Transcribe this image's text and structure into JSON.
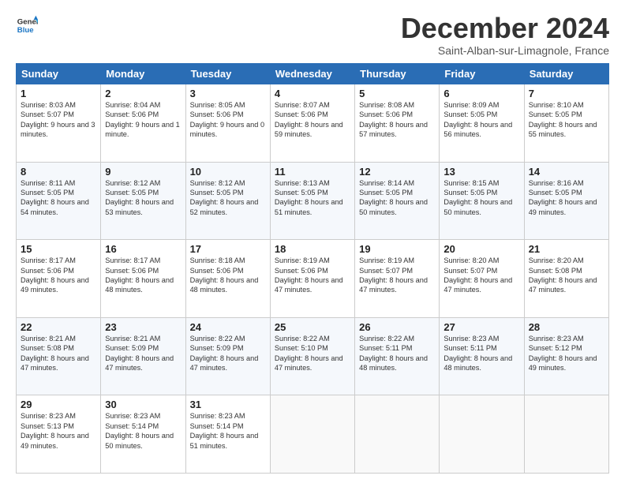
{
  "logo": {
    "line1": "General",
    "line2": "Blue"
  },
  "title": "December 2024",
  "subtitle": "Saint-Alban-sur-Limagnole, France",
  "headers": [
    "Sunday",
    "Monday",
    "Tuesday",
    "Wednesday",
    "Thursday",
    "Friday",
    "Saturday"
  ],
  "weeks": [
    [
      {
        "day": "1",
        "sunrise": "8:03 AM",
        "sunset": "5:07 PM",
        "daylight": "9 hours and 3 minutes."
      },
      {
        "day": "2",
        "sunrise": "8:04 AM",
        "sunset": "5:06 PM",
        "daylight": "9 hours and 1 minute."
      },
      {
        "day": "3",
        "sunrise": "8:05 AM",
        "sunset": "5:06 PM",
        "daylight": "9 hours and 0 minutes."
      },
      {
        "day": "4",
        "sunrise": "8:07 AM",
        "sunset": "5:06 PM",
        "daylight": "8 hours and 59 minutes."
      },
      {
        "day": "5",
        "sunrise": "8:08 AM",
        "sunset": "5:06 PM",
        "daylight": "8 hours and 57 minutes."
      },
      {
        "day": "6",
        "sunrise": "8:09 AM",
        "sunset": "5:05 PM",
        "daylight": "8 hours and 56 minutes."
      },
      {
        "day": "7",
        "sunrise": "8:10 AM",
        "sunset": "5:05 PM",
        "daylight": "8 hours and 55 minutes."
      }
    ],
    [
      {
        "day": "8",
        "sunrise": "8:11 AM",
        "sunset": "5:05 PM",
        "daylight": "8 hours and 54 minutes."
      },
      {
        "day": "9",
        "sunrise": "8:12 AM",
        "sunset": "5:05 PM",
        "daylight": "8 hours and 53 minutes."
      },
      {
        "day": "10",
        "sunrise": "8:12 AM",
        "sunset": "5:05 PM",
        "daylight": "8 hours and 52 minutes."
      },
      {
        "day": "11",
        "sunrise": "8:13 AM",
        "sunset": "5:05 PM",
        "daylight": "8 hours and 51 minutes."
      },
      {
        "day": "12",
        "sunrise": "8:14 AM",
        "sunset": "5:05 PM",
        "daylight": "8 hours and 50 minutes."
      },
      {
        "day": "13",
        "sunrise": "8:15 AM",
        "sunset": "5:05 PM",
        "daylight": "8 hours and 50 minutes."
      },
      {
        "day": "14",
        "sunrise": "8:16 AM",
        "sunset": "5:05 PM",
        "daylight": "8 hours and 49 minutes."
      }
    ],
    [
      {
        "day": "15",
        "sunrise": "8:17 AM",
        "sunset": "5:06 PM",
        "daylight": "8 hours and 49 minutes."
      },
      {
        "day": "16",
        "sunrise": "8:17 AM",
        "sunset": "5:06 PM",
        "daylight": "8 hours and 48 minutes."
      },
      {
        "day": "17",
        "sunrise": "8:18 AM",
        "sunset": "5:06 PM",
        "daylight": "8 hours and 48 minutes."
      },
      {
        "day": "18",
        "sunrise": "8:19 AM",
        "sunset": "5:06 PM",
        "daylight": "8 hours and 47 minutes."
      },
      {
        "day": "19",
        "sunrise": "8:19 AM",
        "sunset": "5:07 PM",
        "daylight": "8 hours and 47 minutes."
      },
      {
        "day": "20",
        "sunrise": "8:20 AM",
        "sunset": "5:07 PM",
        "daylight": "8 hours and 47 minutes."
      },
      {
        "day": "21",
        "sunrise": "8:20 AM",
        "sunset": "5:08 PM",
        "daylight": "8 hours and 47 minutes."
      }
    ],
    [
      {
        "day": "22",
        "sunrise": "8:21 AM",
        "sunset": "5:08 PM",
        "daylight": "8 hours and 47 minutes."
      },
      {
        "day": "23",
        "sunrise": "8:21 AM",
        "sunset": "5:09 PM",
        "daylight": "8 hours and 47 minutes."
      },
      {
        "day": "24",
        "sunrise": "8:22 AM",
        "sunset": "5:09 PM",
        "daylight": "8 hours and 47 minutes."
      },
      {
        "day": "25",
        "sunrise": "8:22 AM",
        "sunset": "5:10 PM",
        "daylight": "8 hours and 47 minutes."
      },
      {
        "day": "26",
        "sunrise": "8:22 AM",
        "sunset": "5:11 PM",
        "daylight": "8 hours and 48 minutes."
      },
      {
        "day": "27",
        "sunrise": "8:23 AM",
        "sunset": "5:11 PM",
        "daylight": "8 hours and 48 minutes."
      },
      {
        "day": "28",
        "sunrise": "8:23 AM",
        "sunset": "5:12 PM",
        "daylight": "8 hours and 49 minutes."
      }
    ],
    [
      {
        "day": "29",
        "sunrise": "8:23 AM",
        "sunset": "5:13 PM",
        "daylight": "8 hours and 49 minutes."
      },
      {
        "day": "30",
        "sunrise": "8:23 AM",
        "sunset": "5:14 PM",
        "daylight": "8 hours and 50 minutes."
      },
      {
        "day": "31",
        "sunrise": "8:23 AM",
        "sunset": "5:14 PM",
        "daylight": "8 hours and 51 minutes."
      },
      null,
      null,
      null,
      null
    ]
  ]
}
